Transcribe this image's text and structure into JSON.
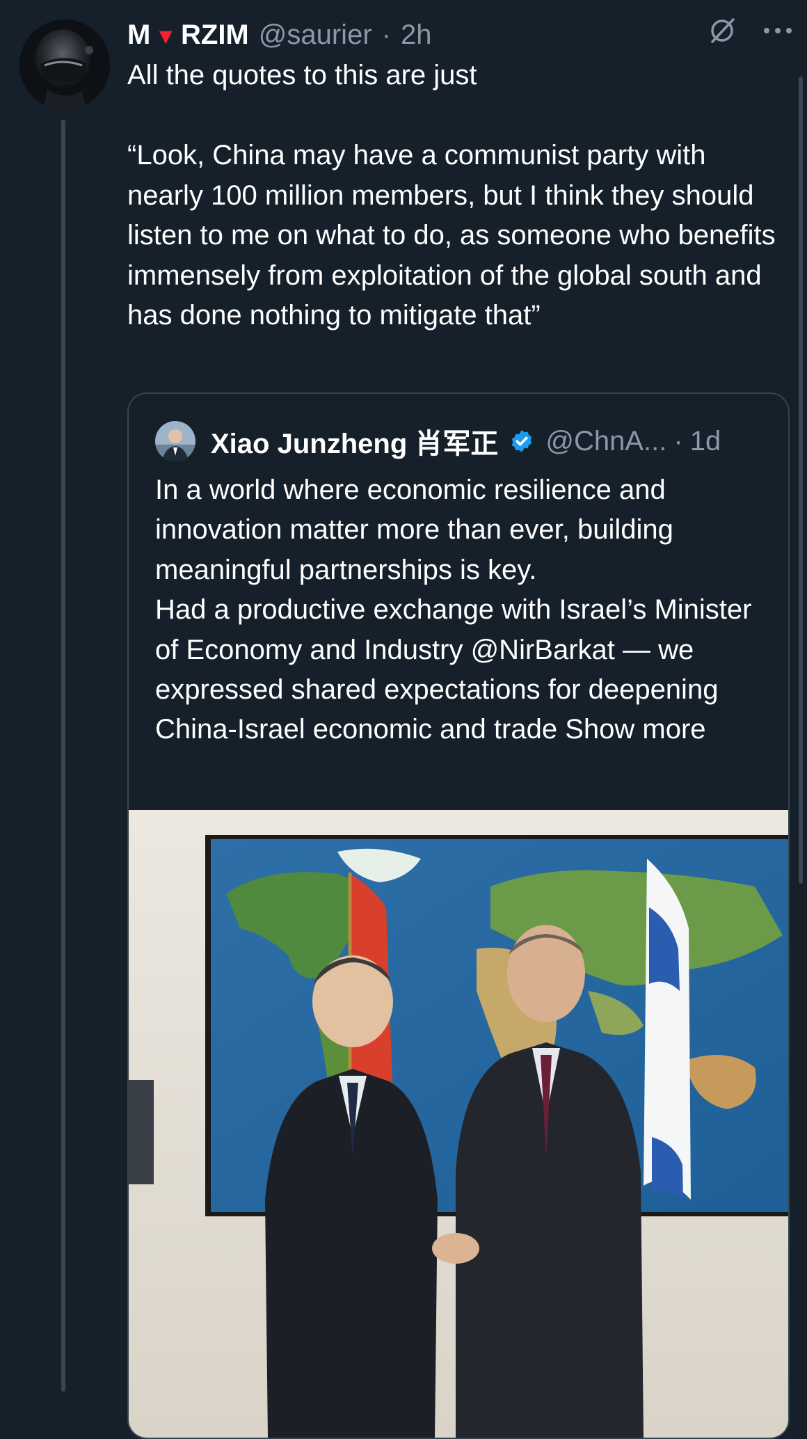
{
  "post": {
    "display_name_left": "M",
    "display_name_right": "RZIM",
    "display_name_symbol": "▼",
    "handle": "@saurier",
    "separator": "·",
    "age": "2h",
    "text_lines": [
      "All the quotes to this are just",
      "",
      "“Look, China may have a communist party with nearly 100 million members, but I think they should listen to me on what to do, as someone who benefits immensely from exploitation of the global south and has done nothing to mitigate that”"
    ]
  },
  "quoted": {
    "display_name": "Xiao Junzheng 肖军正",
    "handle": "@ChnA...",
    "separator": "·",
    "age": "1d",
    "text_lines": [
      "In a world where economic resilience and innovation matter more than ever, building meaningful partnerships is key.",
      "Had a productive exchange with Israel’s Minister of Economy and Industry @NirBarkat — we expressed shared expectations for deepening China-Israel economic and trade"
    ],
    "show_more": "Show more"
  },
  "icons": {
    "grok": "grok-icon",
    "more": "more-icon",
    "verified": "verified-icon"
  },
  "colors": {
    "background": "#15202b",
    "muted_text": "#8b98a5",
    "verified_blue": "#1d9bf0",
    "name_symbol_red": "#f4212e",
    "border": "#38444d"
  }
}
